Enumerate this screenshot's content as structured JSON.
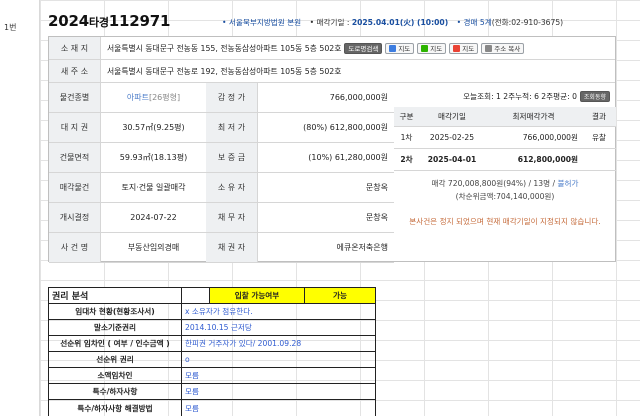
{
  "sheet": {
    "row_label": "1번"
  },
  "header": {
    "case_year": "2024",
    "case_type": "타경",
    "case_number": "112971",
    "court": "• 서울북부지방법원 본원",
    "auction_date_label": "• 매각기일 : ",
    "auction_date": "2025.04.01(火) (10:00)",
    "dept_label": "• 경매 5계",
    "dept_phone": "(전화:02-910-3675)"
  },
  "property": {
    "address_label": "소 재 지",
    "address": "서울특별시 동대문구 전농동 155, 전농동삼성아파트 105동 5층 502호",
    "new_address_label": "새 주 소",
    "new_address": "서울특별시 동대문구 전농로 192, 전농동삼성아파트 105동 5층 502호",
    "buttons": {
      "road_search": "도로명검색",
      "map_d": "지도",
      "map_n": "지도",
      "map_g": "지도",
      "copy_address": "주소 복사"
    },
    "rows": [
      {
        "label": "물건종별",
        "value": "아파트",
        "value_extra": "[26평형]",
        "label2": "감 정 가",
        "value2": "766,000,000원"
      },
      {
        "label": "대 지 권",
        "value": "30.57㎡(9.25평)",
        "label2": "최 저 가",
        "value2": "(80%) 612,800,000원"
      },
      {
        "label": "건물면적",
        "value": "59.93㎡(18.13평)",
        "label2": "보 증 금",
        "value2": "(10%) 61,280,000원"
      },
      {
        "label": "매각물건",
        "value": "토지·건물 일괄매각",
        "label2": "소 유 자",
        "value2": "문창옥"
      },
      {
        "label": "개시결정",
        "value": "2024-07-22",
        "label2": "채 무 자",
        "value2": "문창옥"
      },
      {
        "label": "사 건 명",
        "value": "부동산임의경매",
        "label2": "채 권 자",
        "value2": "에큐온저축은행"
      }
    ]
  },
  "views": {
    "text": "오늘조회: 1  2주누적: 6  2주평균: 0",
    "button": "조회동향"
  },
  "history": {
    "headers": [
      "구분",
      "매각기일",
      "최저매각가격",
      "결과"
    ],
    "rows": [
      [
        "1차",
        "2025-02-25",
        "766,000,000원",
        "유찰"
      ],
      [
        "2차",
        "2025-04-01",
        "612,800,000원",
        ""
      ]
    ],
    "summary_1": "매각 720,008,800원(94%) / 13명 / ",
    "summary_link": "불허가",
    "summary_2": "(차순위금액:704,140,000원)",
    "note": "본사건은 정지 되었으며 현재 매각기일이 지정되지 않습니다."
  },
  "rights": {
    "title": "권리 분석",
    "bid_label": "입찰 가능여부",
    "bid_value": "가능",
    "rows": [
      {
        "label": "임대차 현황(현황조사서)",
        "value": "x 소유자가 점유한다."
      },
      {
        "label": "말소기준권리",
        "value": "2014.10.15 근저당"
      },
      {
        "label": "선순위 임차인 ( 여부 / 인수금액 )",
        "value": "한피권 거주자가 있다/ 2001.09.28"
      },
      {
        "label": "선순위 권리",
        "value": "o"
      },
      {
        "label": "소액임차인",
        "value": "모름"
      },
      {
        "label": "특수/하자사항",
        "value": "모름"
      },
      {
        "label": "특수/하자사항 해결방법",
        "value": "모름"
      }
    ]
  },
  "colors": {
    "accent_blue": "#1a4fa0",
    "link": "#4a7bc8",
    "yellow": "#ffff00",
    "note": "#c56b3b"
  }
}
